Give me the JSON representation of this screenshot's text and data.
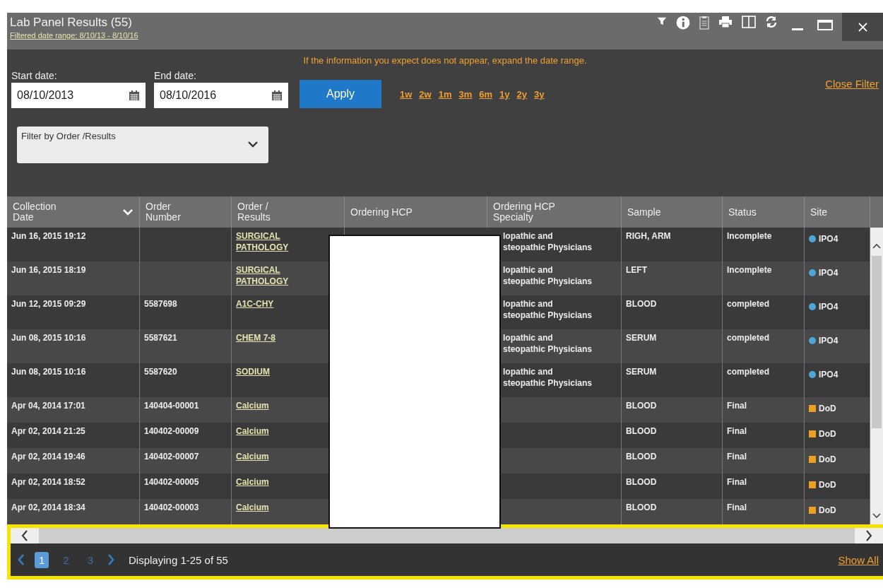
{
  "window": {
    "title": "Lab Panel Results (55)",
    "subtitle": "Filtered date range: 8/10/13 - 8/10/16"
  },
  "filter": {
    "notice": "If the information you expect does not appear, expand the date range.",
    "start_label": "Start date:",
    "start_value": "08/10/2013",
    "end_label": "End date:",
    "end_value": "08/10/2016",
    "apply": "Apply",
    "ranges": [
      "1w",
      "2w",
      "1m",
      "3m",
      "6m",
      "1y",
      "2y",
      "3y"
    ],
    "close": "Close Filter",
    "dropdown": "Filter by Order /Results"
  },
  "table": {
    "columns": [
      {
        "label": "Collection Date",
        "sorted": true
      },
      {
        "label": "Order Number",
        "sorted": false
      },
      {
        "label": "Order / Results",
        "sorted": false
      },
      {
        "label": "Ordering HCP",
        "sorted": false
      },
      {
        "label": "Ordering HCP Specialty",
        "sorted": false
      },
      {
        "label": "Sample",
        "sorted": false
      },
      {
        "label": "Status",
        "sorted": false
      },
      {
        "label": "Site",
        "sorted": false
      }
    ],
    "rows": [
      {
        "date": "Jun 16, 2015 19:12",
        "order": "",
        "result": "SURGICAL PATHOLOGY",
        "specialty": [
          "lopathic and",
          "steopathic Physicians"
        ],
        "sample": "RIGH, ARM",
        "status": "Incomplete",
        "site": {
          "label": "IPO4",
          "color": "#4aa8d8",
          "kind": "circle"
        }
      },
      {
        "date": "Jun 16, 2015 18:19",
        "order": "",
        "result": "SURGICAL PATHOLOGY",
        "specialty": [
          "lopathic and",
          "steopathic Physicians"
        ],
        "sample": "LEFT",
        "status": "Incomplete",
        "site": {
          "label": "IPO4",
          "color": "#4aa8d8",
          "kind": "circle"
        }
      },
      {
        "date": "Jun 12, 2015 09:29",
        "order": "5587698",
        "result": "A1C-CHY",
        "specialty": [
          "lopathic and",
          "steopathic Physicians"
        ],
        "sample": "BLOOD",
        "status": "completed",
        "site": {
          "label": "IPO4",
          "color": "#4aa8d8",
          "kind": "circle"
        }
      },
      {
        "date": "Jun 08, 2015 10:16",
        "order": "5587621",
        "result": "CHEM 7-8",
        "specialty": [
          "lopathic and",
          "steopathic Physicians"
        ],
        "sample": "SERUM",
        "status": "completed",
        "site": {
          "label": "IPO4",
          "color": "#4aa8d8",
          "kind": "circle"
        }
      },
      {
        "date": "Jun 08, 2015 10:16",
        "order": "5587620",
        "result": "SODIUM",
        "specialty": [
          "lopathic and",
          "steopathic Physicians"
        ],
        "sample": "SERUM",
        "status": "completed",
        "site": {
          "label": "IPO4",
          "color": "#4aa8d8",
          "kind": "circle"
        }
      },
      {
        "date": "Apr 04, 2014 17:01",
        "order": "140404-00001",
        "result": "Calcium",
        "specialty": [],
        "sample": "BLOOD",
        "status": "Final",
        "site": {
          "label": "DoD",
          "color": "#f0a020",
          "kind": "square"
        }
      },
      {
        "date": "Apr 02, 2014 21:25",
        "order": "140402-00009",
        "result": "Calcium",
        "specialty": [],
        "sample": "BLOOD",
        "status": "Final",
        "site": {
          "label": "DoD",
          "color": "#f0a020",
          "kind": "square"
        }
      },
      {
        "date": "Apr 02, 2014 19:46",
        "order": "140402-00007",
        "result": "Calcium",
        "specialty": [],
        "sample": "BLOOD",
        "status": "Final",
        "site": {
          "label": "DoD",
          "color": "#f0a020",
          "kind": "square"
        }
      },
      {
        "date": "Apr 02, 2014 18:52",
        "order": "140402-00005",
        "result": "Calcium",
        "specialty": [],
        "sample": "BLOOD",
        "status": "Final",
        "site": {
          "label": "DoD",
          "color": "#f0a020",
          "kind": "square"
        }
      },
      {
        "date": "Apr 02, 2014 18:34",
        "order": "140402-00003",
        "result": "Calcium",
        "specialty": [],
        "sample": "BLOOD",
        "status": "Final",
        "site": {
          "label": "DoD",
          "color": "#f0a020",
          "kind": "square"
        }
      }
    ]
  },
  "pagination": {
    "pages": [
      {
        "label": "1",
        "selected": true
      },
      {
        "label": "2",
        "selected": false
      },
      {
        "label": "3",
        "selected": false
      }
    ],
    "summary": "Displaying 1-25 of 55",
    "show_all": "Show All"
  }
}
